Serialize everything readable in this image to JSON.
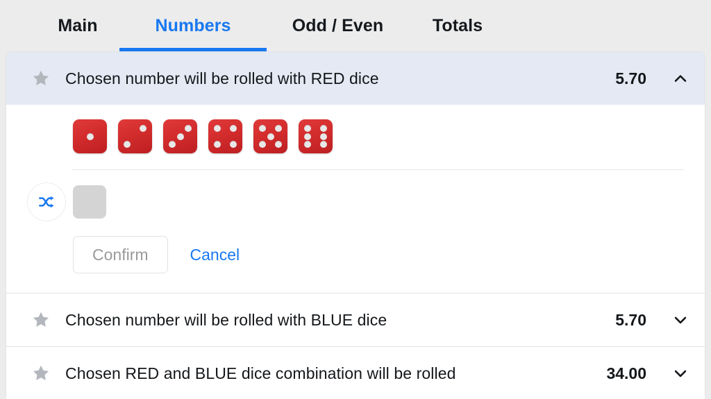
{
  "tabs": [
    {
      "label": "Main",
      "active": false
    },
    {
      "label": "Numbers",
      "active": true
    },
    {
      "label": "Odd / Even",
      "active": false
    },
    {
      "label": "Totals",
      "active": false
    }
  ],
  "colors": {
    "accent": "#1878f2",
    "header_expanded_bg": "#e4e9f3",
    "die_red": "#d42d2d",
    "star_gray": "#b3b7bd",
    "slot_gray": "#d4d4d4"
  },
  "markets": [
    {
      "title": "Chosen number will be rolled with RED dice",
      "odds": "5.70",
      "expanded": true,
      "chevron": "chevron-up-icon",
      "favorite_icon": "star-icon"
    },
    {
      "title": "Chosen number will be rolled with BLUE dice",
      "odds": "5.70",
      "expanded": false,
      "chevron": "chevron-down-icon",
      "favorite_icon": "star-icon"
    },
    {
      "title": "Chosen RED and BLUE dice combination will be rolled",
      "odds": "34.00",
      "expanded": false,
      "chevron": "chevron-down-icon",
      "favorite_icon": "star-icon"
    }
  ],
  "selector": {
    "dice": [
      {
        "face": 1,
        "color": "red",
        "label": "red-die-1"
      },
      {
        "face": 2,
        "color": "red",
        "label": "red-die-2"
      },
      {
        "face": 3,
        "color": "red",
        "label": "red-die-3"
      },
      {
        "face": 4,
        "color": "red",
        "label": "red-die-4"
      },
      {
        "face": 5,
        "color": "red",
        "label": "red-die-5"
      },
      {
        "face": 6,
        "color": "red",
        "label": "red-die-6"
      }
    ],
    "shuffle_icon": "shuffle-icon",
    "slot_value": "",
    "confirm_label": "Confirm",
    "confirm_enabled": false,
    "cancel_label": "Cancel"
  }
}
